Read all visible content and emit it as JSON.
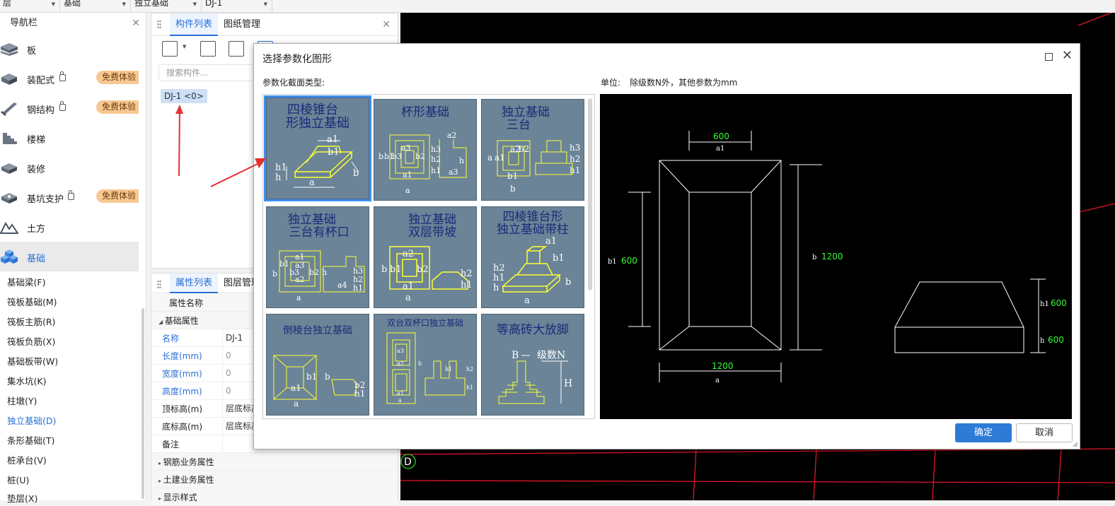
{
  "topbar": {
    "floor": "层",
    "category": "基础",
    "type": "独立基础",
    "component": "DJ-1"
  },
  "nav": {
    "title": "导航栏",
    "categories": [
      {
        "label": "板",
        "icon": "slab-icon"
      },
      {
        "label": "装配式",
        "icon": "prefab-icon",
        "badge": "免费体验"
      },
      {
        "label": "钢结构",
        "icon": "steel-icon",
        "badge": "免费体验"
      },
      {
        "label": "楼梯",
        "icon": "stair-icon"
      },
      {
        "label": "装修",
        "icon": "decoration-icon"
      },
      {
        "label": "基坑支护",
        "icon": "pit-support-icon",
        "badge": "免费体验"
      },
      {
        "label": "土方",
        "icon": "earthwork-icon"
      },
      {
        "label": "基础",
        "icon": "foundation-icon"
      }
    ],
    "sub_items": [
      "基础梁(F)",
      "筏板基础(M)",
      "筏板主筋(R)",
      "筏板负筋(X)",
      "基础板带(W)",
      "集水坑(K)",
      "柱墩(Y)",
      "独立基础(D)",
      "条形基础(T)",
      "桩承台(V)",
      "桩(U)",
      "垫层(X)"
    ]
  },
  "component_panel": {
    "tab_active": "构件列表",
    "tab_other": "图纸管理",
    "search_placeholder": "搜索构件...",
    "item": "DJ-1 <0>"
  },
  "property_panel": {
    "tab_active": "属性列表",
    "tab_other": "图层管理",
    "header_name": "属性名称",
    "group_basic": "基础属性",
    "rows": [
      {
        "key": "名称",
        "value": "DJ-1"
      },
      {
        "key": "长度(mm)",
        "value": "0"
      },
      {
        "key": "宽度(mm)",
        "value": "0"
      },
      {
        "key": "高度(mm)",
        "value": "0"
      },
      {
        "key": "顶标高(m)",
        "value": "层底标高"
      },
      {
        "key": "底标高(m)",
        "value": "层底标高"
      },
      {
        "key": "备注",
        "value": ""
      }
    ],
    "groups_collapsed": [
      "钢筋业务属性",
      "土建业务属性",
      "显示样式"
    ]
  },
  "cad": {
    "axis_label": "D"
  },
  "dialog": {
    "title": "选择参数化图形",
    "type_label": "参数化截面类型:",
    "unit_label": "单位:",
    "unit_text": "除级数N外，其他参数为mm",
    "ok": "确定",
    "cancel": "取消",
    "shapes": [
      {
        "title_lines": [
          "四棱锥台",
          "形独立基础"
        ],
        "labels": [
          "a1",
          "b1",
          "h1",
          "h",
          "a",
          "b"
        ]
      },
      {
        "title_lines": [
          "杯形基础"
        ],
        "labels": [
          "a2",
          "a3",
          "b3",
          "b2",
          "b1",
          "b",
          "a1",
          "a",
          "h3",
          "h2",
          "h1",
          "h",
          "a3"
        ]
      },
      {
        "title_lines": [
          "独立基础",
          "三台"
        ],
        "labels": [
          "a2",
          "a1",
          "a",
          "b2",
          "b1",
          "b",
          "h3",
          "h2",
          "h1"
        ]
      },
      {
        "title_lines": [
          "独立基础",
          "三台有杯口"
        ],
        "labels": [
          "a1",
          "a3",
          "a2",
          "b1",
          "b3",
          "b2",
          "b",
          "a",
          "h",
          "h3",
          "h2",
          "h1",
          "a4"
        ]
      },
      {
        "title_lines": [
          "独立基础",
          "双层带坡"
        ],
        "labels": [
          "a2",
          "b2",
          "b1",
          "b",
          "a1",
          "a",
          "h2",
          "h1"
        ]
      },
      {
        "title_lines": [
          "四棱锥台形",
          "独立基础带柱"
        ],
        "labels": [
          "a1",
          "b1",
          "h2",
          "h1",
          "h",
          "b",
          "a"
        ]
      },
      {
        "title_lines": [
          "倒棱台独立基础"
        ],
        "labels": [
          "b1",
          "a1",
          "a",
          "b",
          "b2",
          "h1"
        ]
      },
      {
        "title_lines": [
          "双台双杯口独立基础"
        ],
        "labels": [
          "a3",
          "a2",
          "a1",
          "a",
          "b",
          "h2",
          "h1",
          "h1"
        ]
      },
      {
        "title_lines": [
          "等高砖大放脚"
        ],
        "labels": [
          "B",
          "级数N",
          "H"
        ]
      }
    ],
    "preview": {
      "top_dim_value": "600",
      "top_dim_name": "a1",
      "left_dim_name": "b1",
      "left_dim_value": "600",
      "right_dim_name": "b",
      "right_dim_value": "1200",
      "bottom_dim_value": "1200",
      "bottom_dim_name": "a",
      "h1_name": "h1",
      "h1_value": "600",
      "h_name": "h",
      "h_value": "600"
    }
  },
  "colors": {
    "accent": "#2a6fd6",
    "badge_bg": "#f6c892",
    "cell_bg": "#6b8497",
    "cell_line": "#ffff33",
    "cad_grid": "#e0162b",
    "preview_value": "#33ff33"
  }
}
